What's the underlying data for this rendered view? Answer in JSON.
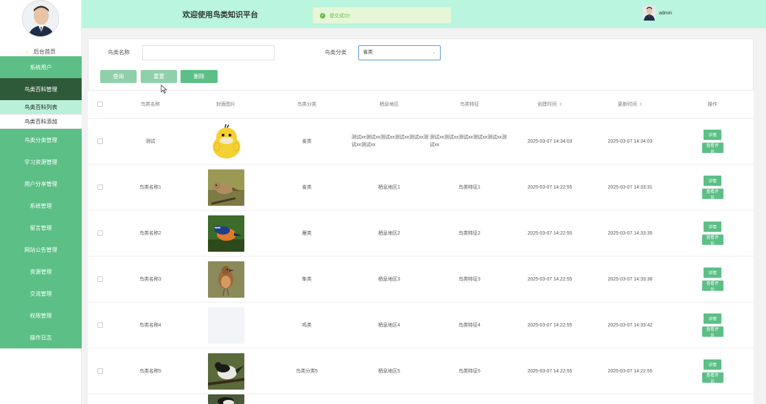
{
  "sidebar": {
    "home_label": "后台首页",
    "menu": [
      {
        "label": "系统用户"
      },
      {
        "label": "鸟类百科管理"
      },
      {
        "label": "鸟类百科列表"
      },
      {
        "label": "鸟类百科添加"
      },
      {
        "label": "鸟类分类管理"
      },
      {
        "label": "学习资源管理"
      },
      {
        "label": "用户分享管理"
      },
      {
        "label": "系统管理"
      },
      {
        "label": "留言管理"
      },
      {
        "label": "网站公告管理"
      },
      {
        "label": "资源管理"
      },
      {
        "label": "交流管理"
      },
      {
        "label": "权限管理"
      },
      {
        "label": "操作日志"
      }
    ]
  },
  "header": {
    "title": "欢迎使用鸟类知识平台",
    "toast": "提交成功!",
    "username": "admin"
  },
  "search": {
    "name_label": "鸟类名称",
    "name_value": "",
    "category_label": "鸟类分类",
    "category_value": "雀类",
    "query_button": "查询",
    "reset_button": "重置",
    "delete_button": "删除"
  },
  "table": {
    "headers": {
      "name": "鸟类名称",
      "cover": "封面图片",
      "category": "鸟类分类",
      "habitat": "栖息地区",
      "feature": "鸟类特征",
      "created": "创建时间",
      "updated": "更新时间",
      "actions": "操作"
    },
    "detail_button": "详情",
    "comment_button": "查看评论",
    "rows": [
      {
        "name": "测试",
        "category": "雀类",
        "habitat": "测试xx测试xx测试xx测试xx测试xx测试xx测试xx",
        "feature": "测试xx测试xx测试xx测试xx测试xx测试xx",
        "created": "2025-03-07 14:34:03",
        "updated": "2025-03-07 14:34:03",
        "image": "duck-cartoon"
      },
      {
        "name": "鸟类名称1",
        "category": "雀类",
        "habitat": "栖息地区1",
        "feature": "鸟类特征1",
        "created": "2025-03-07 14:22:55",
        "updated": "2025-03-07 14:33:31",
        "image": "brown-bird"
      },
      {
        "name": "鸟类名称2",
        "category": "雁类",
        "habitat": "栖息地区2",
        "feature": "鸟类特征2",
        "created": "2025-03-07 14:22:55",
        "updated": "2025-03-07 14:33:35",
        "image": "bluethroat"
      },
      {
        "name": "鸟类名称3",
        "category": "隼类",
        "habitat": "栖息地区3",
        "feature": "鸟类特征3",
        "created": "2025-03-07 14:22:55",
        "updated": "2025-03-07 14:33:38",
        "image": "robin"
      },
      {
        "name": "鸟类名称4",
        "category": "鸡类",
        "habitat": "栖息地区4",
        "feature": "鸟类特征4",
        "created": "2025-03-07 14:22:55",
        "updated": "2025-03-07 14:33:42",
        "image": "empty"
      },
      {
        "name": "鸟类名称5",
        "category": "鸟类分类5",
        "habitat": "栖息地区5",
        "feature": "鸟类特征5",
        "created": "2025-03-07 14:22:55",
        "updated": "2025-03-07 14:22:55",
        "image": "magpie"
      }
    ]
  },
  "colors": {
    "primary": "#5cbf86",
    "sidebar_active": "#2f5a3a",
    "header_bg": "#b9f5df",
    "submenu_active": "#b9f0d8"
  }
}
